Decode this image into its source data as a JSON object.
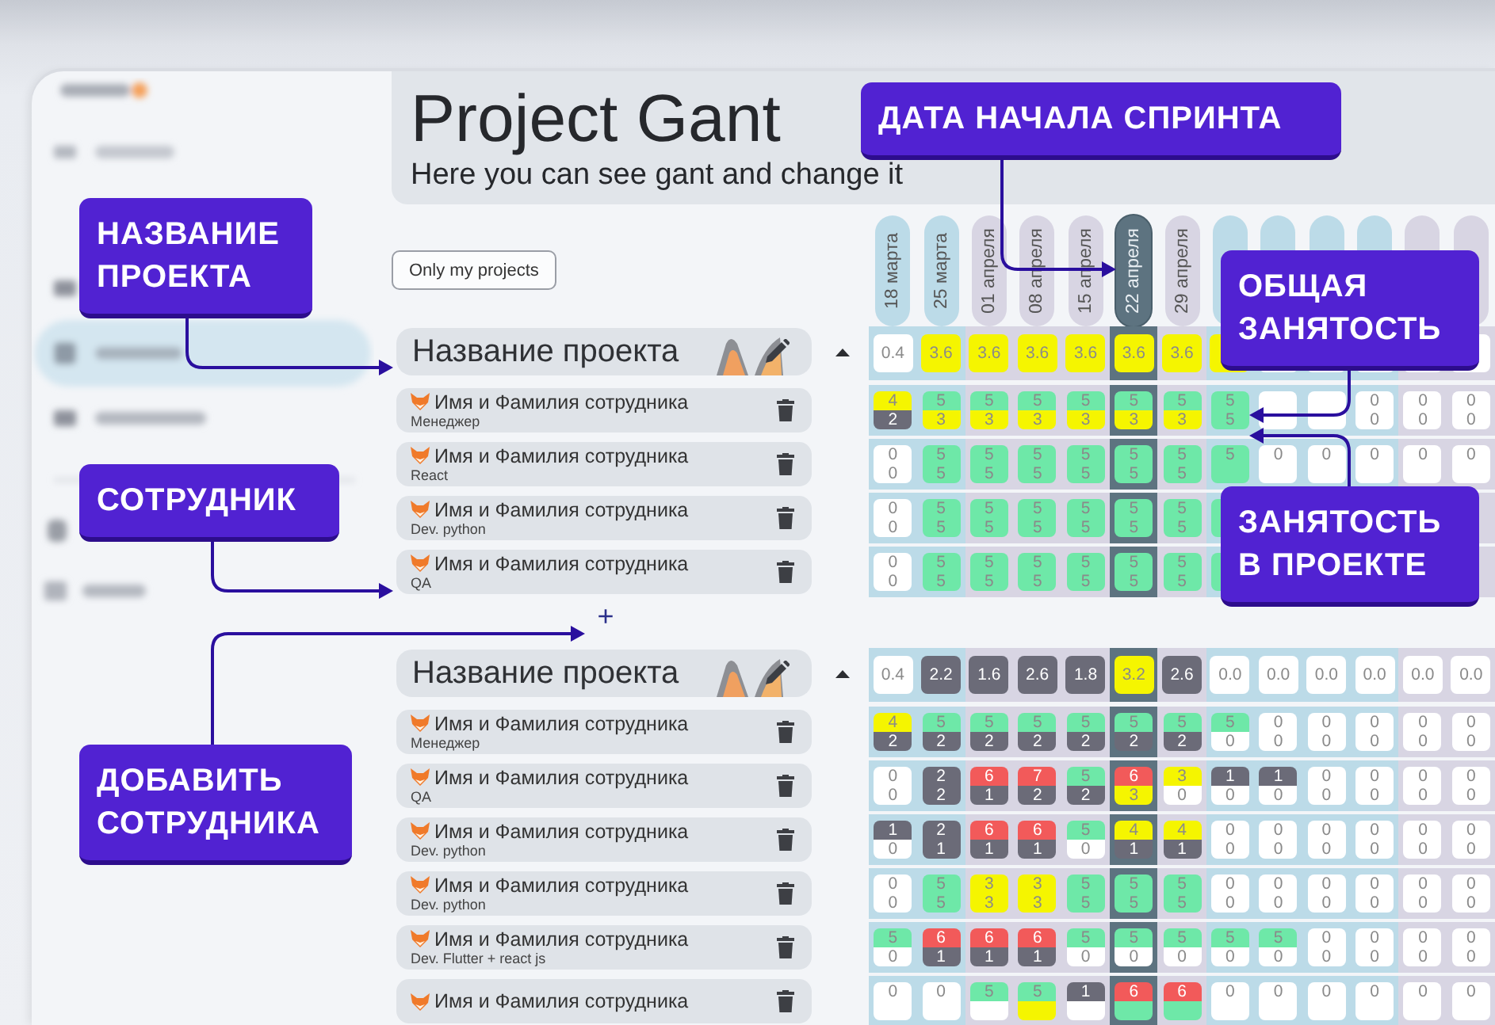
{
  "header": {
    "title": "Project Gant",
    "subtitle": "Here you can see gant and change it"
  },
  "filter_button": "Only my projects",
  "columns": [
    {
      "label": "18 марта",
      "color": "#bcdbe8",
      "selected": false
    },
    {
      "label": "25 марта",
      "color": "#bcdbe8",
      "selected": false
    },
    {
      "label": "01 апреля",
      "color": "#d8d5e3",
      "selected": false
    },
    {
      "label": "08 апреля",
      "color": "#d8d5e3",
      "selected": false
    },
    {
      "label": "15 апреля",
      "color": "#d8d5e3",
      "selected": false
    },
    {
      "label": "22 апреля",
      "color": "#5d7380",
      "selected": true
    },
    {
      "label": "29 апреля",
      "color": "#d8d5e3",
      "selected": false
    },
    {
      "color": "#bcdbe8",
      "selected": false
    },
    {
      "color": "#bcdbe8",
      "selected": false
    },
    {
      "color": "#bcdbe8",
      "selected": false
    },
    {
      "color": "#bcdbe8",
      "selected": false
    },
    {
      "color": "#d8d5e3",
      "selected": false
    },
    {
      "color": "#d8d5e3",
      "selected": false
    }
  ],
  "projects": [
    {
      "name": "Название проекта",
      "totals": [
        {
          "value": "0.4",
          "color": "#ffffff"
        },
        {
          "value": "3.6",
          "color": "#f5f500"
        },
        {
          "value": "3.6",
          "color": "#f5f500"
        },
        {
          "value": "3.6",
          "color": "#f5f500"
        },
        {
          "value": "3.6",
          "color": "#f5f500"
        },
        {
          "value": "3.6",
          "color": "#f5f500"
        },
        {
          "value": "3.6",
          "color": "#f5f500"
        },
        {
          "color": "#f5f500"
        },
        {
          "color": "#ffffff"
        },
        {
          "color": "#ffffff"
        },
        {
          "color": "#ffffff"
        },
        {
          "color": "#ffffff"
        },
        {
          "color": "#ffffff"
        }
      ],
      "rows": [
        {
          "name": "Имя и Фамилия сотрудника",
          "role": "Менеджер",
          "cells": [
            [
              {
                "value": "4",
                "color": "#f5f500"
              },
              {
                "value": "2",
                "color": "#6b6b78"
              }
            ],
            [
              {
                "value": "5",
                "color": "#6ee8a8"
              },
              {
                "value": "3",
                "color": "#f5f500"
              }
            ],
            [
              {
                "value": "5",
                "color": "#6ee8a8"
              },
              {
                "value": "3",
                "color": "#f5f500"
              }
            ],
            [
              {
                "value": "5",
                "color": "#6ee8a8"
              },
              {
                "value": "3",
                "color": "#f5f500"
              }
            ],
            [
              {
                "value": "5",
                "color": "#6ee8a8"
              },
              {
                "value": "3",
                "color": "#f5f500"
              }
            ],
            [
              {
                "value": "5",
                "color": "#6ee8a8"
              },
              {
                "value": "3",
                "color": "#f5f500"
              }
            ],
            [
              {
                "value": "5",
                "color": "#6ee8a8"
              },
              {
                "value": "3",
                "color": "#f5f500"
              }
            ],
            [
              {
                "value": "5",
                "color": "#6ee8a8"
              },
              {
                "value": "5",
                "color": "#6ee8a8"
              }
            ],
            [
              {
                "color": "#ffffff"
              },
              {
                "color": "#ffffff"
              }
            ],
            [
              {
                "color": "#ffffff"
              },
              {
                "color": "#ffffff"
              }
            ],
            [
              {
                "value": "0",
                "color": "#ffffff"
              },
              {
                "value": "0",
                "color": "#ffffff"
              }
            ],
            [
              {
                "value": "0",
                "color": "#ffffff"
              },
              {
                "value": "0",
                "color": "#ffffff"
              }
            ],
            [
              {
                "value": "0",
                "color": "#ffffff"
              },
              {
                "value": "0",
                "color": "#ffffff"
              }
            ]
          ]
        },
        {
          "name": "Имя и Фамилия сотрудника",
          "role": "React",
          "cells": [
            [
              {
                "value": "0",
                "color": "#ffffff"
              },
              {
                "value": "0",
                "color": "#ffffff"
              }
            ],
            [
              {
                "value": "5",
                "color": "#6ee8a8"
              },
              {
                "value": "5",
                "color": "#6ee8a8"
              }
            ],
            [
              {
                "value": "5",
                "color": "#6ee8a8"
              },
              {
                "value": "5",
                "color": "#6ee8a8"
              }
            ],
            [
              {
                "value": "5",
                "color": "#6ee8a8"
              },
              {
                "value": "5",
                "color": "#6ee8a8"
              }
            ],
            [
              {
                "value": "5",
                "color": "#6ee8a8"
              },
              {
                "value": "5",
                "color": "#6ee8a8"
              }
            ],
            [
              {
                "value": "5",
                "color": "#6ee8a8"
              },
              {
                "value": "5",
                "color": "#6ee8a8"
              }
            ],
            [
              {
                "value": "5",
                "color": "#6ee8a8"
              },
              {
                "value": "5",
                "color": "#6ee8a8"
              }
            ],
            [
              {
                "value": "5",
                "color": "#6ee8a8"
              },
              {
                "color": "#6ee8a8"
              }
            ],
            [
              {
                "value": "0",
                "color": "#ffffff"
              },
              {
                "color": "#ffffff"
              }
            ],
            [
              {
                "value": "0",
                "color": "#ffffff"
              },
              {
                "color": "#ffffff"
              }
            ],
            [
              {
                "value": "0",
                "color": "#ffffff"
              },
              {
                "color": "#ffffff"
              }
            ],
            [
              {
                "value": "0",
                "color": "#ffffff"
              },
              {
                "color": "#ffffff"
              }
            ],
            [
              {
                "value": "0",
                "color": "#ffffff"
              },
              {
                "color": "#ffffff"
              }
            ]
          ]
        },
        {
          "name": "Имя и Фамилия сотрудника",
          "role": "Dev. python",
          "cells": [
            [
              {
                "value": "0",
                "color": "#ffffff"
              },
              {
                "value": "0",
                "color": "#ffffff"
              }
            ],
            [
              {
                "value": "5",
                "color": "#6ee8a8"
              },
              {
                "value": "5",
                "color": "#6ee8a8"
              }
            ],
            [
              {
                "value": "5",
                "color": "#6ee8a8"
              },
              {
                "value": "5",
                "color": "#6ee8a8"
              }
            ],
            [
              {
                "value": "5",
                "color": "#6ee8a8"
              },
              {
                "value": "5",
                "color": "#6ee8a8"
              }
            ],
            [
              {
                "value": "5",
                "color": "#6ee8a8"
              },
              {
                "value": "5",
                "color": "#6ee8a8"
              }
            ],
            [
              {
                "value": "5",
                "color": "#6ee8a8"
              },
              {
                "value": "5",
                "color": "#6ee8a8"
              }
            ],
            [
              {
                "value": "5",
                "color": "#6ee8a8"
              },
              {
                "value": "5",
                "color": "#6ee8a8"
              }
            ],
            [
              {
                "color": "#6ee8a8"
              },
              {
                "color": "#6ee8a8"
              }
            ]
          ]
        },
        {
          "name": "Имя и Фамилия сотрудника",
          "role": "QA",
          "cells": [
            [
              {
                "value": "0",
                "color": "#ffffff"
              },
              {
                "value": "0",
                "color": "#ffffff"
              }
            ],
            [
              {
                "value": "5",
                "color": "#6ee8a8"
              },
              {
                "value": "5",
                "color": "#6ee8a8"
              }
            ],
            [
              {
                "value": "5",
                "color": "#6ee8a8"
              },
              {
                "value": "5",
                "color": "#6ee8a8"
              }
            ],
            [
              {
                "value": "5",
                "color": "#6ee8a8"
              },
              {
                "value": "5",
                "color": "#6ee8a8"
              }
            ],
            [
              {
                "value": "5",
                "color": "#6ee8a8"
              },
              {
                "value": "5",
                "color": "#6ee8a8"
              }
            ],
            [
              {
                "value": "5",
                "color": "#6ee8a8"
              },
              {
                "value": "5",
                "color": "#6ee8a8"
              }
            ],
            [
              {
                "value": "5",
                "color": "#6ee8a8"
              },
              {
                "value": "5",
                "color": "#6ee8a8"
              }
            ],
            [
              {
                "color": "#6ee8a8"
              },
              {
                "color": "#6ee8a8"
              }
            ]
          ]
        }
      ],
      "add_label": "+"
    },
    {
      "name": "Название проекта",
      "totals": [
        {
          "value": "0.4",
          "color": "#ffffff"
        },
        {
          "value": "2.2",
          "color": "#6b6b78"
        },
        {
          "value": "1.6",
          "color": "#6b6b78"
        },
        {
          "value": "2.6",
          "color": "#6b6b78"
        },
        {
          "value": "1.8",
          "color": "#6b6b78"
        },
        {
          "value": "3.2",
          "color": "#f5f500"
        },
        {
          "value": "2.6",
          "color": "#6b6b78"
        },
        {
          "value": "0.0",
          "color": "#ffffff"
        },
        {
          "value": "0.0",
          "color": "#ffffff"
        },
        {
          "value": "0.0",
          "color": "#ffffff"
        },
        {
          "value": "0.0",
          "color": "#ffffff"
        },
        {
          "value": "0.0",
          "color": "#ffffff"
        },
        {
          "value": "0.0",
          "color": "#ffffff"
        }
      ],
      "rows": [
        {
          "name": "Имя и Фамилия сотрудника",
          "role": "Менеджер",
          "cells": [
            [
              {
                "value": "4",
                "color": "#f5f500"
              },
              {
                "value": "2",
                "color": "#6b6b78"
              }
            ],
            [
              {
                "value": "5",
                "color": "#6ee8a8"
              },
              {
                "value": "2",
                "color": "#6b6b78"
              }
            ],
            [
              {
                "value": "5",
                "color": "#6ee8a8"
              },
              {
                "value": "2",
                "color": "#6b6b78"
              }
            ],
            [
              {
                "value": "5",
                "color": "#6ee8a8"
              },
              {
                "value": "2",
                "color": "#6b6b78"
              }
            ],
            [
              {
                "value": "5",
                "color": "#6ee8a8"
              },
              {
                "value": "2",
                "color": "#6b6b78"
              }
            ],
            [
              {
                "value": "5",
                "color": "#6ee8a8"
              },
              {
                "value": "2",
                "color": "#6b6b78"
              }
            ],
            [
              {
                "value": "5",
                "color": "#6ee8a8"
              },
              {
                "value": "2",
                "color": "#6b6b78"
              }
            ],
            [
              {
                "value": "5",
                "color": "#6ee8a8"
              },
              {
                "value": "0",
                "color": "#ffffff"
              }
            ],
            [
              {
                "value": "0",
                "color": "#ffffff"
              },
              {
                "value": "0",
                "color": "#ffffff"
              }
            ],
            [
              {
                "value": "0",
                "color": "#ffffff"
              },
              {
                "value": "0",
                "color": "#ffffff"
              }
            ],
            [
              {
                "value": "0",
                "color": "#ffffff"
              },
              {
                "value": "0",
                "color": "#ffffff"
              }
            ],
            [
              {
                "value": "0",
                "color": "#ffffff"
              },
              {
                "value": "0",
                "color": "#ffffff"
              }
            ],
            [
              {
                "value": "0",
                "color": "#ffffff"
              },
              {
                "value": "0",
                "color": "#ffffff"
              }
            ]
          ]
        },
        {
          "name": "Имя и Фамилия сотрудника",
          "role": "QA",
          "cells": [
            [
              {
                "value": "0",
                "color": "#ffffff"
              },
              {
                "value": "0",
                "color": "#ffffff"
              }
            ],
            [
              {
                "value": "2",
                "color": "#6b6b78"
              },
              {
                "value": "2",
                "color": "#6b6b78"
              }
            ],
            [
              {
                "value": "6",
                "color": "#f25a5a"
              },
              {
                "value": "1",
                "color": "#6b6b78"
              }
            ],
            [
              {
                "value": "7",
                "color": "#f25a5a"
              },
              {
                "value": "2",
                "color": "#6b6b78"
              }
            ],
            [
              {
                "value": "5",
                "color": "#6ee8a8"
              },
              {
                "value": "2",
                "color": "#6b6b78"
              }
            ],
            [
              {
                "value": "6",
                "color": "#f25a5a"
              },
              {
                "value": "3",
                "color": "#f5f500"
              }
            ],
            [
              {
                "value": "3",
                "color": "#f5f500"
              },
              {
                "value": "0",
                "color": "#ffffff"
              }
            ],
            [
              {
                "value": "1",
                "color": "#6b6b78"
              },
              {
                "value": "0",
                "color": "#ffffff"
              }
            ],
            [
              {
                "value": "1",
                "color": "#6b6b78"
              },
              {
                "value": "0",
                "color": "#ffffff"
              }
            ],
            [
              {
                "value": "0",
                "color": "#ffffff"
              },
              {
                "value": "0",
                "color": "#ffffff"
              }
            ],
            [
              {
                "value": "0",
                "color": "#ffffff"
              },
              {
                "value": "0",
                "color": "#ffffff"
              }
            ],
            [
              {
                "value": "0",
                "color": "#ffffff"
              },
              {
                "value": "0",
                "color": "#ffffff"
              }
            ],
            [
              {
                "value": "0",
                "color": "#ffffff"
              },
              {
                "value": "0",
                "color": "#ffffff"
              }
            ]
          ]
        },
        {
          "name": "Имя и Фамилия сотрудника",
          "role": "Dev. python",
          "cells": [
            [
              {
                "value": "1",
                "color": "#6b6b78"
              },
              {
                "value": "0",
                "color": "#ffffff"
              }
            ],
            [
              {
                "value": "2",
                "color": "#6b6b78"
              },
              {
                "value": "1",
                "color": "#6b6b78"
              }
            ],
            [
              {
                "value": "6",
                "color": "#f25a5a"
              },
              {
                "value": "1",
                "color": "#6b6b78"
              }
            ],
            [
              {
                "value": "6",
                "color": "#f25a5a"
              },
              {
                "value": "1",
                "color": "#6b6b78"
              }
            ],
            [
              {
                "value": "5",
                "color": "#6ee8a8"
              },
              {
                "value": "0",
                "color": "#ffffff"
              }
            ],
            [
              {
                "value": "4",
                "color": "#f5f500"
              },
              {
                "value": "1",
                "color": "#6b6b78"
              }
            ],
            [
              {
                "value": "4",
                "color": "#f5f500"
              },
              {
                "value": "1",
                "color": "#6b6b78"
              }
            ],
            [
              {
                "value": "0",
                "color": "#ffffff"
              },
              {
                "value": "0",
                "color": "#ffffff"
              }
            ],
            [
              {
                "value": "0",
                "color": "#ffffff"
              },
              {
                "value": "0",
                "color": "#ffffff"
              }
            ],
            [
              {
                "value": "0",
                "color": "#ffffff"
              },
              {
                "value": "0",
                "color": "#ffffff"
              }
            ],
            [
              {
                "value": "0",
                "color": "#ffffff"
              },
              {
                "value": "0",
                "color": "#ffffff"
              }
            ],
            [
              {
                "value": "0",
                "color": "#ffffff"
              },
              {
                "value": "0",
                "color": "#ffffff"
              }
            ],
            [
              {
                "value": "0",
                "color": "#ffffff"
              },
              {
                "value": "0",
                "color": "#ffffff"
              }
            ]
          ]
        },
        {
          "name": "Имя и Фамилия сотрудника",
          "role": "Dev. python",
          "cells": [
            [
              {
                "value": "0",
                "color": "#ffffff"
              },
              {
                "value": "0",
                "color": "#ffffff"
              }
            ],
            [
              {
                "value": "5",
                "color": "#6ee8a8"
              },
              {
                "value": "5",
                "color": "#6ee8a8"
              }
            ],
            [
              {
                "value": "3",
                "color": "#f5f500"
              },
              {
                "value": "3",
                "color": "#f5f500"
              }
            ],
            [
              {
                "value": "3",
                "color": "#f5f500"
              },
              {
                "value": "3",
                "color": "#f5f500"
              }
            ],
            [
              {
                "value": "5",
                "color": "#6ee8a8"
              },
              {
                "value": "5",
                "color": "#6ee8a8"
              }
            ],
            [
              {
                "value": "5",
                "color": "#6ee8a8"
              },
              {
                "value": "5",
                "color": "#6ee8a8"
              }
            ],
            [
              {
                "value": "5",
                "color": "#6ee8a8"
              },
              {
                "value": "5",
                "color": "#6ee8a8"
              }
            ],
            [
              {
                "value": "0",
                "color": "#ffffff"
              },
              {
                "value": "0",
                "color": "#ffffff"
              }
            ],
            [
              {
                "value": "0",
                "color": "#ffffff"
              },
              {
                "value": "0",
                "color": "#ffffff"
              }
            ],
            [
              {
                "value": "0",
                "color": "#ffffff"
              },
              {
                "value": "0",
                "color": "#ffffff"
              }
            ],
            [
              {
                "value": "0",
                "color": "#ffffff"
              },
              {
                "value": "0",
                "color": "#ffffff"
              }
            ],
            [
              {
                "value": "0",
                "color": "#ffffff"
              },
              {
                "value": "0",
                "color": "#ffffff"
              }
            ],
            [
              {
                "value": "0",
                "color": "#ffffff"
              },
              {
                "value": "0",
                "color": "#ffffff"
              }
            ]
          ]
        },
        {
          "name": "Имя и Фамилия сотрудника",
          "role": "Dev. Flutter + react js",
          "cells": [
            [
              {
                "value": "5",
                "color": "#6ee8a8"
              },
              {
                "value": "0",
                "color": "#ffffff"
              }
            ],
            [
              {
                "value": "6",
                "color": "#f25a5a"
              },
              {
                "value": "1",
                "color": "#6b6b78"
              }
            ],
            [
              {
                "value": "6",
                "color": "#f25a5a"
              },
              {
                "value": "1",
                "color": "#6b6b78"
              }
            ],
            [
              {
                "value": "6",
                "color": "#f25a5a"
              },
              {
                "value": "1",
                "color": "#6b6b78"
              }
            ],
            [
              {
                "value": "5",
                "color": "#6ee8a8"
              },
              {
                "value": "0",
                "color": "#ffffff"
              }
            ],
            [
              {
                "value": "5",
                "color": "#6ee8a8"
              },
              {
                "value": "0",
                "color": "#ffffff"
              }
            ],
            [
              {
                "value": "5",
                "color": "#6ee8a8"
              },
              {
                "value": "0",
                "color": "#ffffff"
              }
            ],
            [
              {
                "value": "5",
                "color": "#6ee8a8"
              },
              {
                "value": "0",
                "color": "#ffffff"
              }
            ],
            [
              {
                "value": "5",
                "color": "#6ee8a8"
              },
              {
                "value": "0",
                "color": "#ffffff"
              }
            ],
            [
              {
                "value": "0",
                "color": "#ffffff"
              },
              {
                "value": "0",
                "color": "#ffffff"
              }
            ],
            [
              {
                "value": "0",
                "color": "#ffffff"
              },
              {
                "value": "0",
                "color": "#ffffff"
              }
            ],
            [
              {
                "value": "0",
                "color": "#ffffff"
              },
              {
                "value": "0",
                "color": "#ffffff"
              }
            ],
            [
              {
                "value": "0",
                "color": "#ffffff"
              },
              {
                "value": "0",
                "color": "#ffffff"
              }
            ]
          ]
        },
        {
          "name": "Имя и Фамилия сотрудника",
          "cells": [
            [
              {
                "value": "0",
                "color": "#ffffff"
              },
              {
                "color": "#ffffff"
              }
            ],
            [
              {
                "value": "0",
                "color": "#ffffff"
              },
              {
                "color": "#ffffff"
              }
            ],
            [
              {
                "value": "5",
                "color": "#6ee8a8"
              },
              {
                "color": "#ffffff"
              }
            ],
            [
              {
                "value": "5",
                "color": "#6ee8a8"
              },
              {
                "color": "#f5f500"
              }
            ],
            [
              {
                "value": "1",
                "color": "#6b6b78"
              },
              {
                "color": "#ffffff"
              }
            ],
            [
              {
                "value": "6",
                "color": "#f25a5a"
              },
              {
                "color": "#6ee8a8"
              }
            ],
            [
              {
                "value": "6",
                "color": "#f25a5a"
              },
              {
                "color": "#6ee8a8"
              }
            ],
            [
              {
                "value": "0",
                "color": "#ffffff"
              },
              {
                "color": "#ffffff"
              }
            ],
            [
              {
                "value": "0",
                "color": "#ffffff"
              },
              {
                "color": "#ffffff"
              }
            ],
            [
              {
                "value": "0",
                "color": "#ffffff"
              },
              {
                "color": "#ffffff"
              }
            ],
            [
              {
                "value": "0",
                "color": "#ffffff"
              },
              {
                "color": "#ffffff"
              }
            ],
            [
              {
                "value": "0",
                "color": "#ffffff"
              },
              {
                "color": "#ffffff"
              }
            ],
            [
              {
                "value": "0",
                "color": "#ffffff"
              },
              {
                "color": "#ffffff"
              }
            ]
          ]
        }
      ]
    }
  ],
  "callouts": [
    {
      "text": "ДАТА НАЧАЛА СПРИНТА"
    },
    {
      "text": "НАЗВАНИЕ ПРОЕКТА"
    },
    {
      "text": "ОБЩАЯ ЗАНЯТОСТЬ"
    },
    {
      "text": "СОТРУДНИК"
    },
    {
      "text": "ЗАНЯТОСТЬ В ПРОЕКТЕ"
    },
    {
      "text": "ДОБАВИТЬ СОТРУДНИКА"
    }
  ]
}
